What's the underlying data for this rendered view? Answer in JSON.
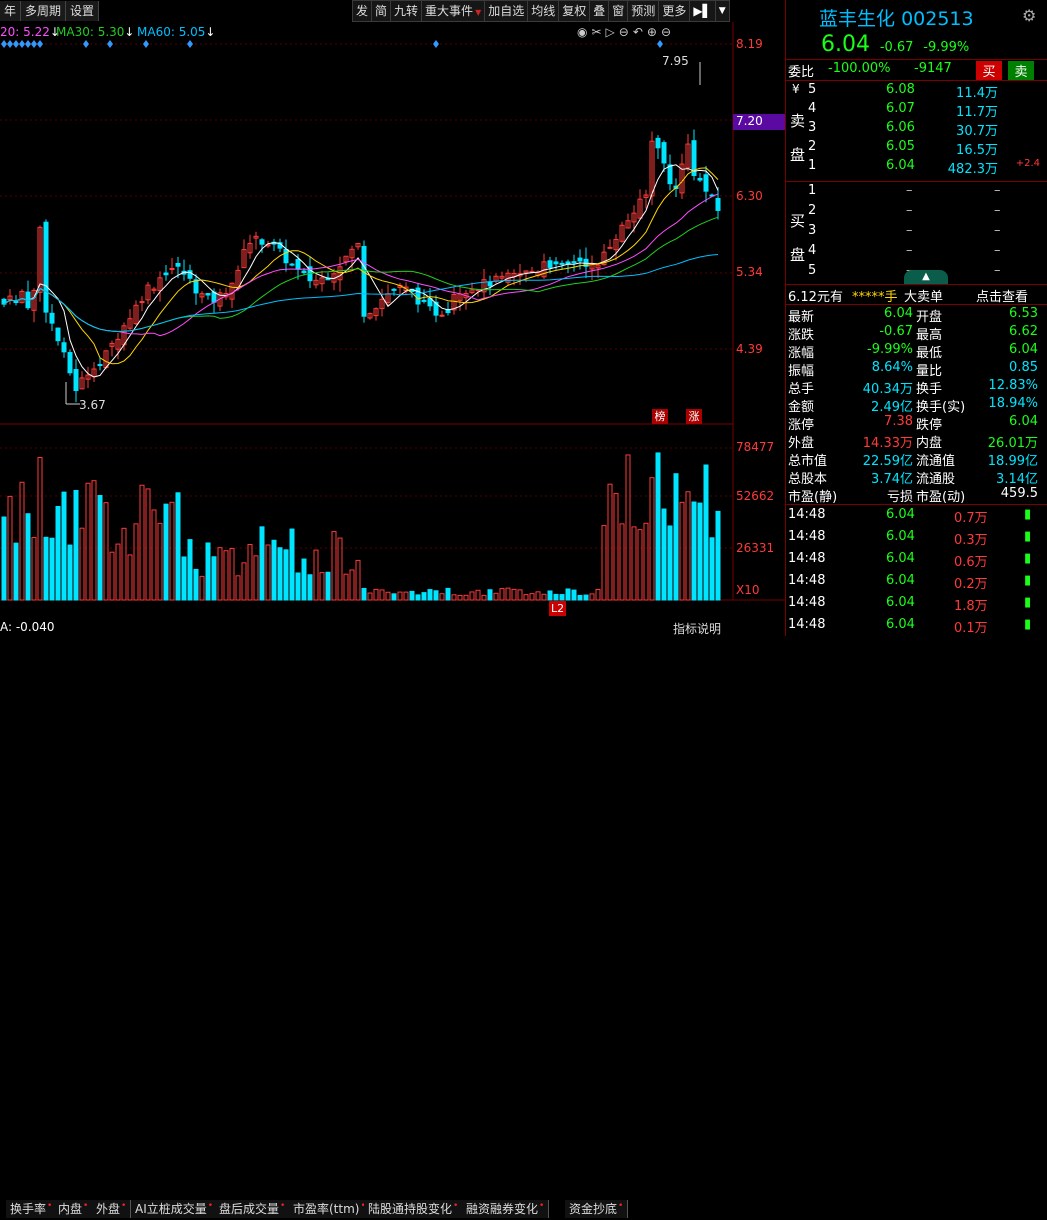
{
  "toolbar_left": [
    "年",
    "多周期",
    "设置"
  ],
  "toolbar_right": [
    {
      "label": "发",
      "dd": false
    },
    {
      "label": "简",
      "dd": false
    },
    {
      "label": "九转",
      "dd": false
    },
    {
      "label": "重大事件",
      "dd": true
    },
    {
      "label": "加自选",
      "dd": false
    },
    {
      "label": "均线",
      "dd": false
    },
    {
      "label": "复权",
      "dd": false
    },
    {
      "label": "叠",
      "dd": false
    },
    {
      "label": "窗",
      "dd": false
    },
    {
      "label": "预测",
      "dd": false
    },
    {
      "label": "更多",
      "dd": false
    }
  ],
  "ma": {
    "ma20": "20: 5.22",
    "ma30": "MA30: 5.30",
    "ma60": "MA60: 5.05"
  },
  "price_axis": [
    "8.19",
    "7.20",
    "6.30",
    "5.34",
    "4.39"
  ],
  "volume_axis": [
    "78477",
    "52662",
    "26331",
    "X10"
  ],
  "annotations": {
    "high": "7.95",
    "low": "3.67",
    "bang": "榜",
    "zhang": "涨"
  },
  "stock": {
    "name": "蓝丰生化",
    "code": "002513",
    "price": "6.04",
    "change": "-0.67",
    "pct": "-9.99%"
  },
  "weibi": {
    "label": "委比",
    "ratio": "-100.00%",
    "diff": "-9147",
    "buy": "买",
    "sell": "卖"
  },
  "sell_book": [
    {
      "lvl": "5",
      "price": "6.08",
      "vol": "11.4万",
      "extra": ""
    },
    {
      "lvl": "4",
      "price": "6.07",
      "vol": "11.7万",
      "extra": ""
    },
    {
      "lvl": "3",
      "price": "6.06",
      "vol": "30.7万",
      "extra": ""
    },
    {
      "lvl": "2",
      "price": "6.05",
      "vol": "16.5万",
      "extra": ""
    },
    {
      "lvl": "1",
      "price": "6.04",
      "vol": "482.3万",
      "extra": "+2.4"
    }
  ],
  "buy_book": [
    {
      "lvl": "1",
      "price": "–",
      "vol": "–"
    },
    {
      "lvl": "2",
      "price": "–",
      "vol": "–"
    },
    {
      "lvl": "3",
      "price": "–",
      "vol": "–"
    },
    {
      "lvl": "4",
      "price": "–",
      "vol": "–"
    },
    {
      "lvl": "5",
      "price": "–",
      "vol": "–"
    }
  ],
  "sell_side_label": [
    "卖",
    "盘"
  ],
  "buy_side_label": [
    "买",
    "盘"
  ],
  "yen": "¥",
  "big_order": {
    "price": "6.12元有",
    "stars": "*****手",
    "label": "大卖单",
    "link": "点击查看"
  },
  "quote": [
    {
      "l": "最新",
      "v": "6.04",
      "vc": "green",
      "l2": "开盘",
      "v2": "6.53",
      "v2c": "green"
    },
    {
      "l": "涨跌",
      "v": "-0.67",
      "vc": "green",
      "l2": "最高",
      "v2": "6.62",
      "v2c": "green"
    },
    {
      "l": "涨幅",
      "v": "-9.99%",
      "vc": "green",
      "l2": "最低",
      "v2": "6.04",
      "v2c": "green"
    },
    {
      "l": "振幅",
      "v": "8.64%",
      "vc": "cyan",
      "l2": "量比",
      "v2": "0.85",
      "v2c": "cyan"
    },
    {
      "l": "总手",
      "v": "40.34万",
      "vc": "cyan",
      "l2": "换手",
      "v2": "12.83%",
      "v2c": "cyan"
    },
    {
      "l": "金额",
      "v": "2.49亿",
      "vc": "cyan",
      "l2": "换手(实)",
      "v2": "18.94%",
      "v2c": "cyan"
    },
    {
      "l": "涨停",
      "v": "7.38",
      "vc": "red",
      "l2": "跌停",
      "v2": "6.04",
      "v2c": "green"
    },
    {
      "l": "外盘",
      "v": "14.33万",
      "vc": "red",
      "l2": "内盘",
      "v2": "26.01万",
      "v2c": "green"
    },
    {
      "l": "总市值",
      "v": "22.59亿",
      "vc": "cyan",
      "l2": "流通值",
      "v2": "18.99亿",
      "v2c": "cyan"
    },
    {
      "l": "总股本",
      "v": "3.74亿",
      "vc": "cyan",
      "l2": "流通股",
      "v2": "3.14亿",
      "v2c": "cyan"
    },
    {
      "l": "市盈(静)",
      "v": "亏损",
      "vc": "white",
      "l2": "市盈(动)",
      "v2": "459.5",
      "v2c": "white"
    }
  ],
  "ticks": [
    {
      "t": "14:48",
      "p": "6.04",
      "v": "0.7万"
    },
    {
      "t": "14:48",
      "p": "6.04",
      "v": "0.3万"
    },
    {
      "t": "14:48",
      "p": "6.04",
      "v": "0.6万"
    },
    {
      "t": "14:48",
      "p": "6.04",
      "v": "0.2万"
    },
    {
      "t": "14:48",
      "p": "6.04",
      "v": "1.8万"
    },
    {
      "t": "14:48",
      "p": "6.04",
      "v": "0.1万"
    }
  ],
  "bottom_tabs": [
    "换手率",
    "内盘",
    "外盘",
    "AI立桩成交量",
    "盘后成交量",
    "市盈率(ttm)",
    "陆股通持股变化",
    "融资融券变化",
    "资金抄底"
  ],
  "l2": "L2",
  "indicator_desc": "指标说明",
  "bottom_left": "A: -0.040",
  "icons": [
    "eye-icon",
    "scissors-icon",
    "play-icon",
    "minus-circle-icon",
    "undo-icon",
    "zoom-in-icon",
    "zoom-out-icon"
  ],
  "colors": {
    "up": "#ff3a3a",
    "down": "#00e5ff",
    "ma5": "#ffffff",
    "ma10": "#ffd700",
    "ma20": "#ff4dff",
    "ma30": "#22cc22",
    "ma60": "#00bfff"
  }
}
